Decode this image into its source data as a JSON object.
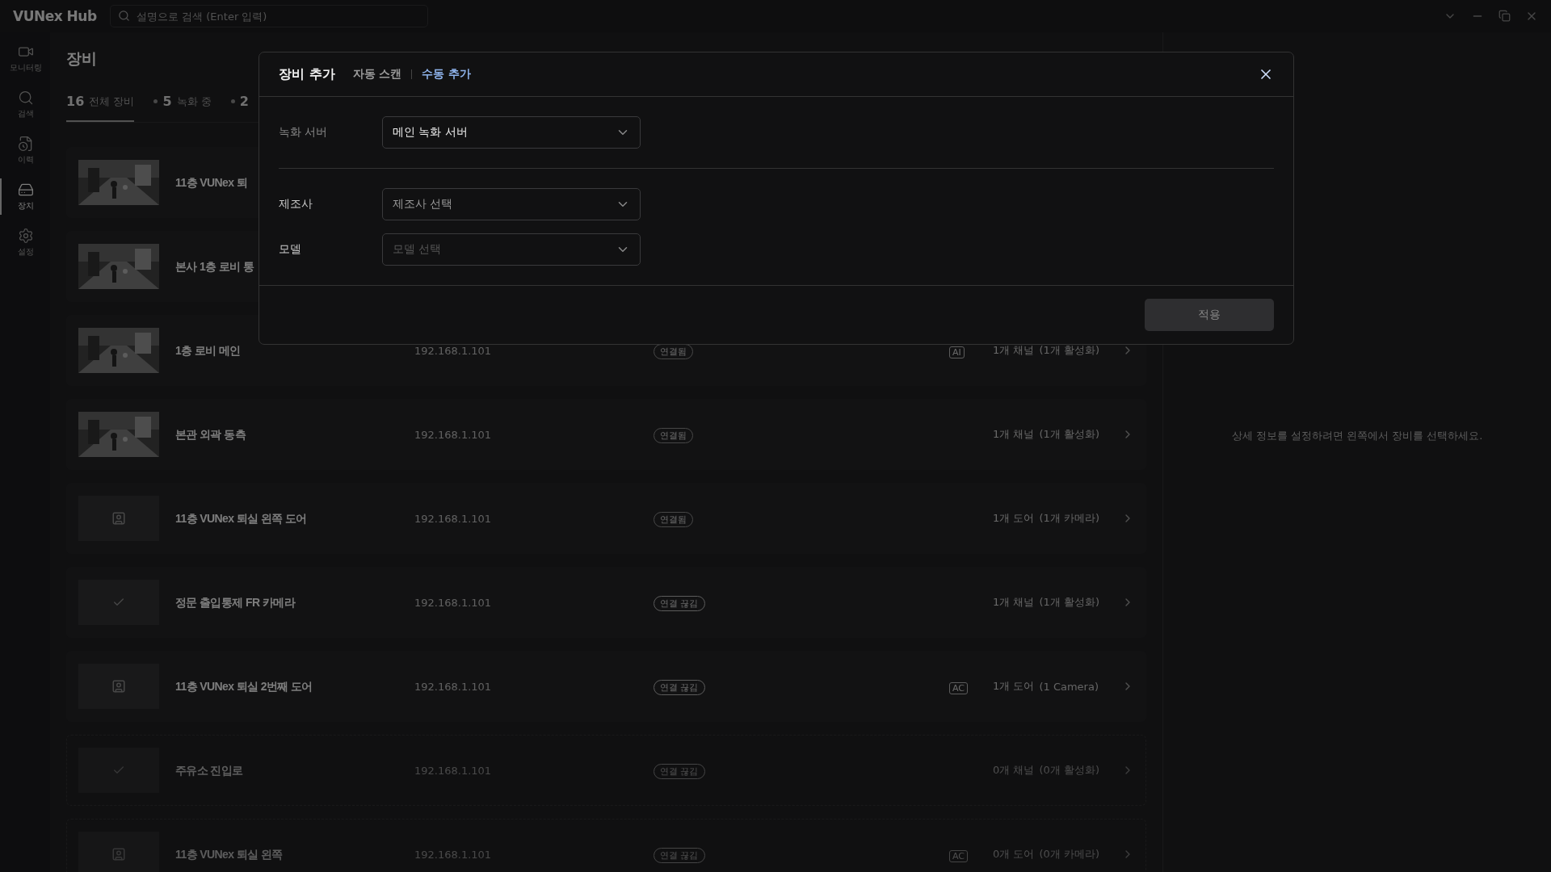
{
  "app": {
    "logo": "VUNex Hub",
    "search": {
      "placeholder": "설명으로 검색 (Enter 입력)"
    }
  },
  "sidebar": {
    "items": [
      {
        "label": "모니터링",
        "kind": "video",
        "selected": false
      },
      {
        "label": "검색",
        "kind": "search",
        "selected": false
      },
      {
        "label": "이력",
        "kind": "history",
        "selected": false
      },
      {
        "label": "장치",
        "kind": "device",
        "selected": true
      },
      {
        "label": "설정",
        "kind": "settings",
        "selected": false
      }
    ]
  },
  "page": {
    "title": "장비",
    "stats": [
      {
        "count": "16",
        "label": "전체 장비",
        "kind": "total",
        "selected": true
      },
      {
        "count": "5",
        "label": "녹화 중",
        "kind": "status",
        "selected": false
      },
      {
        "count": "2",
        "kind": "status",
        "selected": false
      }
    ],
    "devices": [
      {
        "name": "11층 VUNex 퇴",
        "kind": "picture",
        "disabled": false
      },
      {
        "name": "본사 1층 로비 통",
        "kind": "picture",
        "disabled": false
      },
      {
        "name": "1층 로비 메인",
        "kind": "picture",
        "ip": "192.168.1.101",
        "status": "연결됨",
        "connected": true,
        "badge": "AI",
        "channels": "1개 채널",
        "detail": "(1개 활성화)",
        "disabled": false
      },
      {
        "name": "본관 외곽 동측",
        "kind": "picture",
        "ip": "192.168.1.101",
        "status": "연결됨",
        "connected": true,
        "channels": "1개 채널",
        "detail": "(1개 활성화)",
        "disabled": false
      },
      {
        "name": "11층 VUNex 퇴실 왼쪽 도어",
        "kind": "door",
        "ip": "192.168.1.101",
        "status": "연결됨",
        "connected": true,
        "channels": "1개 도어",
        "detail": "(1개 카메라)",
        "disabled": false
      },
      {
        "name": "정문 출입통제 FR 카메라",
        "kind": "check",
        "ip": "192.168.1.101",
        "status": "연결 끊김",
        "connected": false,
        "channels": "1개 채널",
        "detail": "(1개 활성화)",
        "disabled": false
      },
      {
        "name": "11층 VUNex 퇴실 2번째 도어",
        "kind": "door",
        "ip": "192.168.1.101",
        "status": "연결 끊김",
        "connected": false,
        "badge": "AC",
        "channels": "1개 도어",
        "detail": "(1 Camera)",
        "disabled": false
      },
      {
        "name": "주유소 진입로",
        "kind": "check",
        "ip": "192.168.1.101",
        "status": "연결 끊김",
        "connected": false,
        "channels": "0개 채널",
        "detail": "(0개 활성화)",
        "disabled": true
      },
      {
        "name": "11층 VUNex 퇴실 왼쪽",
        "kind": "door",
        "ip": "192.168.1.101",
        "status": "연결 끊김",
        "connected": false,
        "badge": "AC",
        "channels": "0개 도어",
        "detail": "(0개 카메라)",
        "disabled": true
      }
    ]
  },
  "detail_panel": {
    "hint": "상세 정보를 설정하려면 왼쪽에서 장비를 선택하세요."
  },
  "dialog": {
    "title": "장비 추가",
    "tabs": [
      {
        "label": "자동 스캔",
        "selected": false
      },
      {
        "label": "수동 추가",
        "selected": true
      }
    ],
    "sections": [
      [
        {
          "label": "녹화 서버",
          "value": "메인 녹화 서버",
          "disabled": false
        }
      ],
      [
        {
          "label": "제조사",
          "placeholder": "제조사 선택",
          "disabled": false
        },
        {
          "label": "모델",
          "placeholder": "모델 선택",
          "disabled": true
        }
      ]
    ],
    "apply": {
      "label": "적용",
      "disabled": true
    }
  }
}
